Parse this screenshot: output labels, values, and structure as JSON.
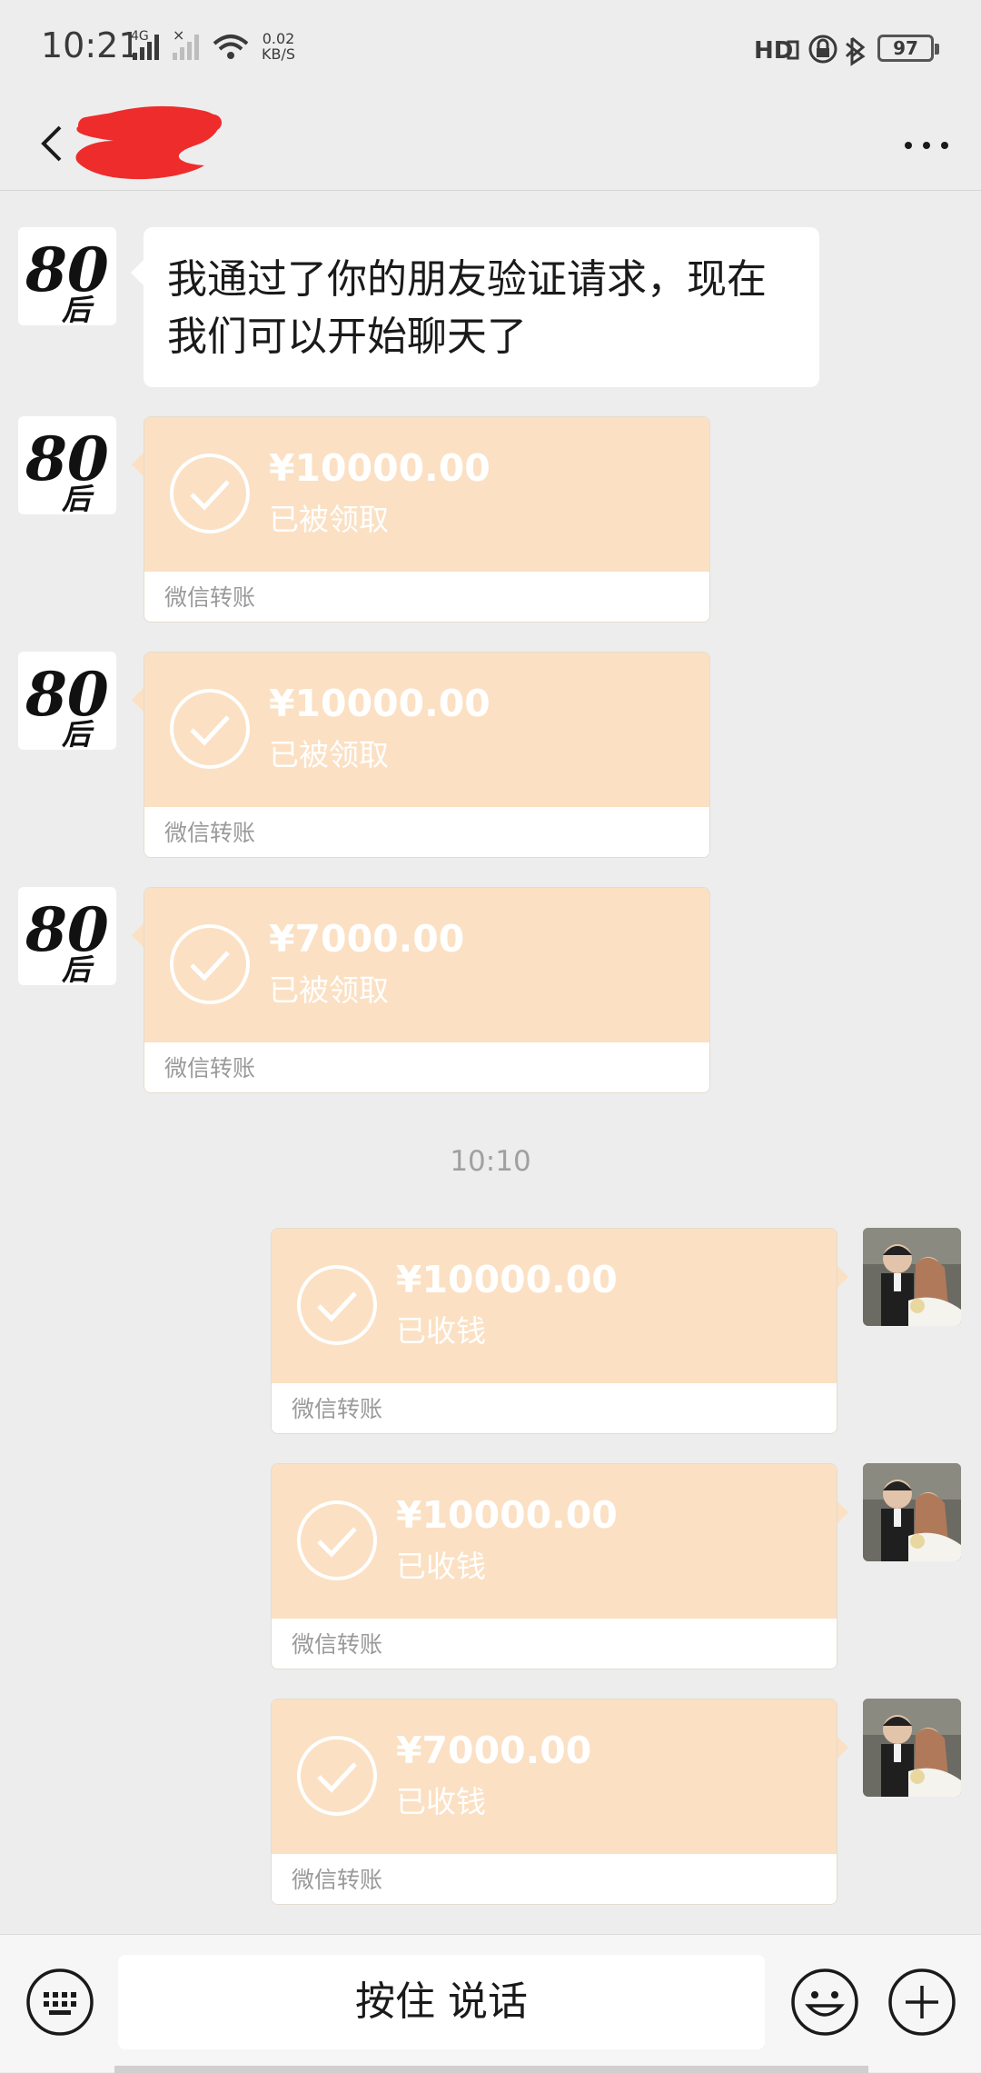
{
  "status_bar": {
    "time": "10:21",
    "net_speed_value": "0.02",
    "net_speed_unit": "KB/S",
    "battery": "97",
    "signal_label": "4G",
    "hd_label": "HD"
  },
  "nav": {
    "back_icon": "back-arrow-icon",
    "more_icon": "more-dots-icon"
  },
  "messages": {
    "greeting_text": "我通过了你的朋友验证请求，现在我们可以开始聊天了",
    "transfers_received": [
      {
        "amount": "¥10000.00",
        "status": "已被领取",
        "footer": "微信转账"
      },
      {
        "amount": "¥10000.00",
        "status": "已被领取",
        "footer": "微信转账"
      },
      {
        "amount": "¥7000.00",
        "status": "已被领取",
        "footer": "微信转账"
      }
    ],
    "timestamp": "10:10",
    "transfers_sent": [
      {
        "amount": "¥10000.00",
        "status": "已收钱",
        "footer": "微信转账"
      },
      {
        "amount": "¥10000.00",
        "status": "已收钱",
        "footer": "微信转账"
      },
      {
        "amount": "¥7000.00",
        "status": "已收钱",
        "footer": "微信转账"
      }
    ]
  },
  "input_bar": {
    "hold_to_talk": "按住 说话",
    "keyboard_icon": "keyboard-icon",
    "emoji_icon": "emoji-icon",
    "plus_icon": "plus-icon"
  },
  "colors": {
    "background": "#ededed",
    "transfer_orange": "#fbe0c3",
    "bubble_white": "#ffffff"
  }
}
